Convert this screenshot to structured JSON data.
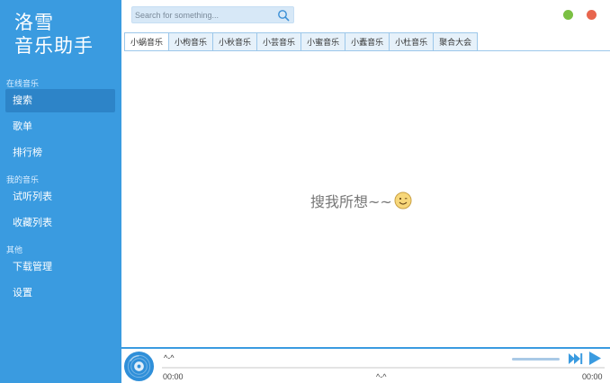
{
  "app": {
    "logo_line1": "洛雪",
    "logo_line2": "音乐助手"
  },
  "sidebar": {
    "groups": [
      {
        "title": "在线音乐",
        "items": [
          {
            "label": "搜索",
            "active": true
          },
          {
            "label": "歌单"
          },
          {
            "label": "排行榜"
          }
        ]
      },
      {
        "title": "我的音乐",
        "items": [
          {
            "label": "试听列表"
          },
          {
            "label": "收藏列表"
          }
        ]
      },
      {
        "title": "其他",
        "items": [
          {
            "label": "下载管理"
          },
          {
            "label": "设置"
          }
        ]
      }
    ]
  },
  "search": {
    "placeholder": "Search for something...",
    "value": "",
    "icon": "search-icon"
  },
  "tabs": [
    {
      "label": "小蜗音乐",
      "active": true
    },
    {
      "label": "小枸音乐"
    },
    {
      "label": "小秋音乐"
    },
    {
      "label": "小芸音乐"
    },
    {
      "label": "小蜜音乐"
    },
    {
      "label": "小蠹音乐"
    },
    {
      "label": "小杜音乐"
    },
    {
      "label": "聚合大会"
    }
  ],
  "content": {
    "empty_message": "搜我所想~~",
    "emoji_icon": "smile-icon"
  },
  "player": {
    "song_title": "^-^",
    "time_current": "00:00",
    "artist": "^-^",
    "time_total": "00:00",
    "progress": 0
  },
  "colors": {
    "accent": "#3a9be0",
    "sidebar_active": "#2d84c8",
    "minimize": "#7bc043",
    "close": "#e8664e"
  }
}
